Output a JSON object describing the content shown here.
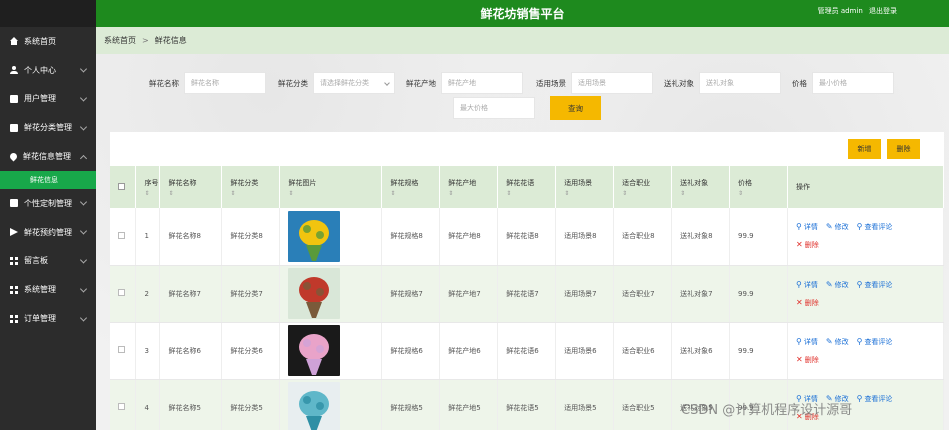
{
  "app": {
    "title": "鲜花坊销售平台",
    "user_label": "管理员 admin",
    "logout": "退出登录"
  },
  "sidebar": {
    "items": [
      {
        "label": "系统首页",
        "icon": "home-icon"
      },
      {
        "label": "个人中心",
        "icon": "user-icon"
      },
      {
        "label": "用户管理",
        "icon": "box-icon"
      },
      {
        "label": "鲜花分类管理",
        "icon": "box-icon"
      },
      {
        "label": "鲜花信息管理",
        "icon": "pin-icon"
      },
      {
        "label": "个性定制管理",
        "icon": "box-icon"
      },
      {
        "label": "鲜花预约管理",
        "icon": "send-icon"
      },
      {
        "label": "留言板",
        "icon": "grid-icon"
      },
      {
        "label": "系统管理",
        "icon": "grid-icon"
      },
      {
        "label": "订单管理",
        "icon": "grid-icon"
      }
    ],
    "sub_active": "鲜花信息"
  },
  "breadcrumb": {
    "home": "系统首页",
    "sep": ">",
    "current": "鲜花信息"
  },
  "search": {
    "name_label": "鲜花名称",
    "name_placeholder": "鲜花名称",
    "category_label": "鲜花分类",
    "category_placeholder": "请选择鲜花分类",
    "origin_label": "鲜花产地",
    "origin_placeholder": "鲜花产地",
    "scene_label": "适用场景",
    "scene_placeholder": "适用场景",
    "target_label": "送礼对象",
    "target_placeholder": "送礼对象",
    "price_label": "价格",
    "min_price_placeholder": "最小价格",
    "max_price_placeholder": "最大价格",
    "query_button": "查询"
  },
  "toolbar": {
    "add": "新增",
    "delete": "删除"
  },
  "table": {
    "headers": [
      "序号",
      "鲜花名称",
      "鲜花分类",
      "鲜花图片",
      "鲜花规格",
      "鲜花产地",
      "鲜花花语",
      "适用场景",
      "适合职业",
      "送礼对象",
      "价格",
      "操作"
    ],
    "header_no": "序\n号.",
    "sort_glyph": "⇕",
    "rows": [
      {
        "no": "1",
        "name": "鲜花名称8",
        "category": "鲜花分类8",
        "spec": "鲜花规格8",
        "origin": "鲜花产地8",
        "language": "鲜花花语8",
        "scene": "适用场景8",
        "job": "适合职业8",
        "target": "送礼对象8",
        "price": "99.9",
        "img_colors": [
          "#2a7fb8",
          "#f1c40f",
          "#5a9a3a"
        ]
      },
      {
        "no": "2",
        "name": "鲜花名称7",
        "category": "鲜花分类7",
        "spec": "鲜花规格7",
        "origin": "鲜花产地7",
        "language": "鲜花花语7",
        "scene": "适用场景7",
        "job": "适合职业7",
        "target": "送礼对象7",
        "price": "99.9",
        "img_colors": [
          "#d9e7d8",
          "#c0392b",
          "#7a5a3a"
        ]
      },
      {
        "no": "3",
        "name": "鲜花名称6",
        "category": "鲜花分类6",
        "spec": "鲜花规格6",
        "origin": "鲜花产地6",
        "language": "鲜花花语6",
        "scene": "适用场景6",
        "job": "适合职业6",
        "target": "送礼对象6",
        "price": "99.9",
        "img_colors": [
          "#1a1a1a",
          "#e9a3c9",
          "#cfa2d8"
        ]
      },
      {
        "no": "4",
        "name": "鲜花名称5",
        "category": "鲜花分类5",
        "spec": "鲜花规格5",
        "origin": "鲜花产地5",
        "language": "鲜花花语5",
        "scene": "适用场景5",
        "job": "适合职业5",
        "target": "送礼对象5",
        "price": "99.9",
        "img_colors": [
          "#e8eef0",
          "#5fb7c9",
          "#2e8fa5"
        ]
      }
    ],
    "ops": {
      "detail": "详情",
      "edit": "修改",
      "review": "查看评论",
      "delete": "删除"
    }
  },
  "watermark": "CSDN @计算机程序设计源哥",
  "colors": {
    "topbar": "#1e8a1e",
    "accent": "#f5b800",
    "sidebar": "#2c2c2c",
    "active": "#18a84a"
  }
}
